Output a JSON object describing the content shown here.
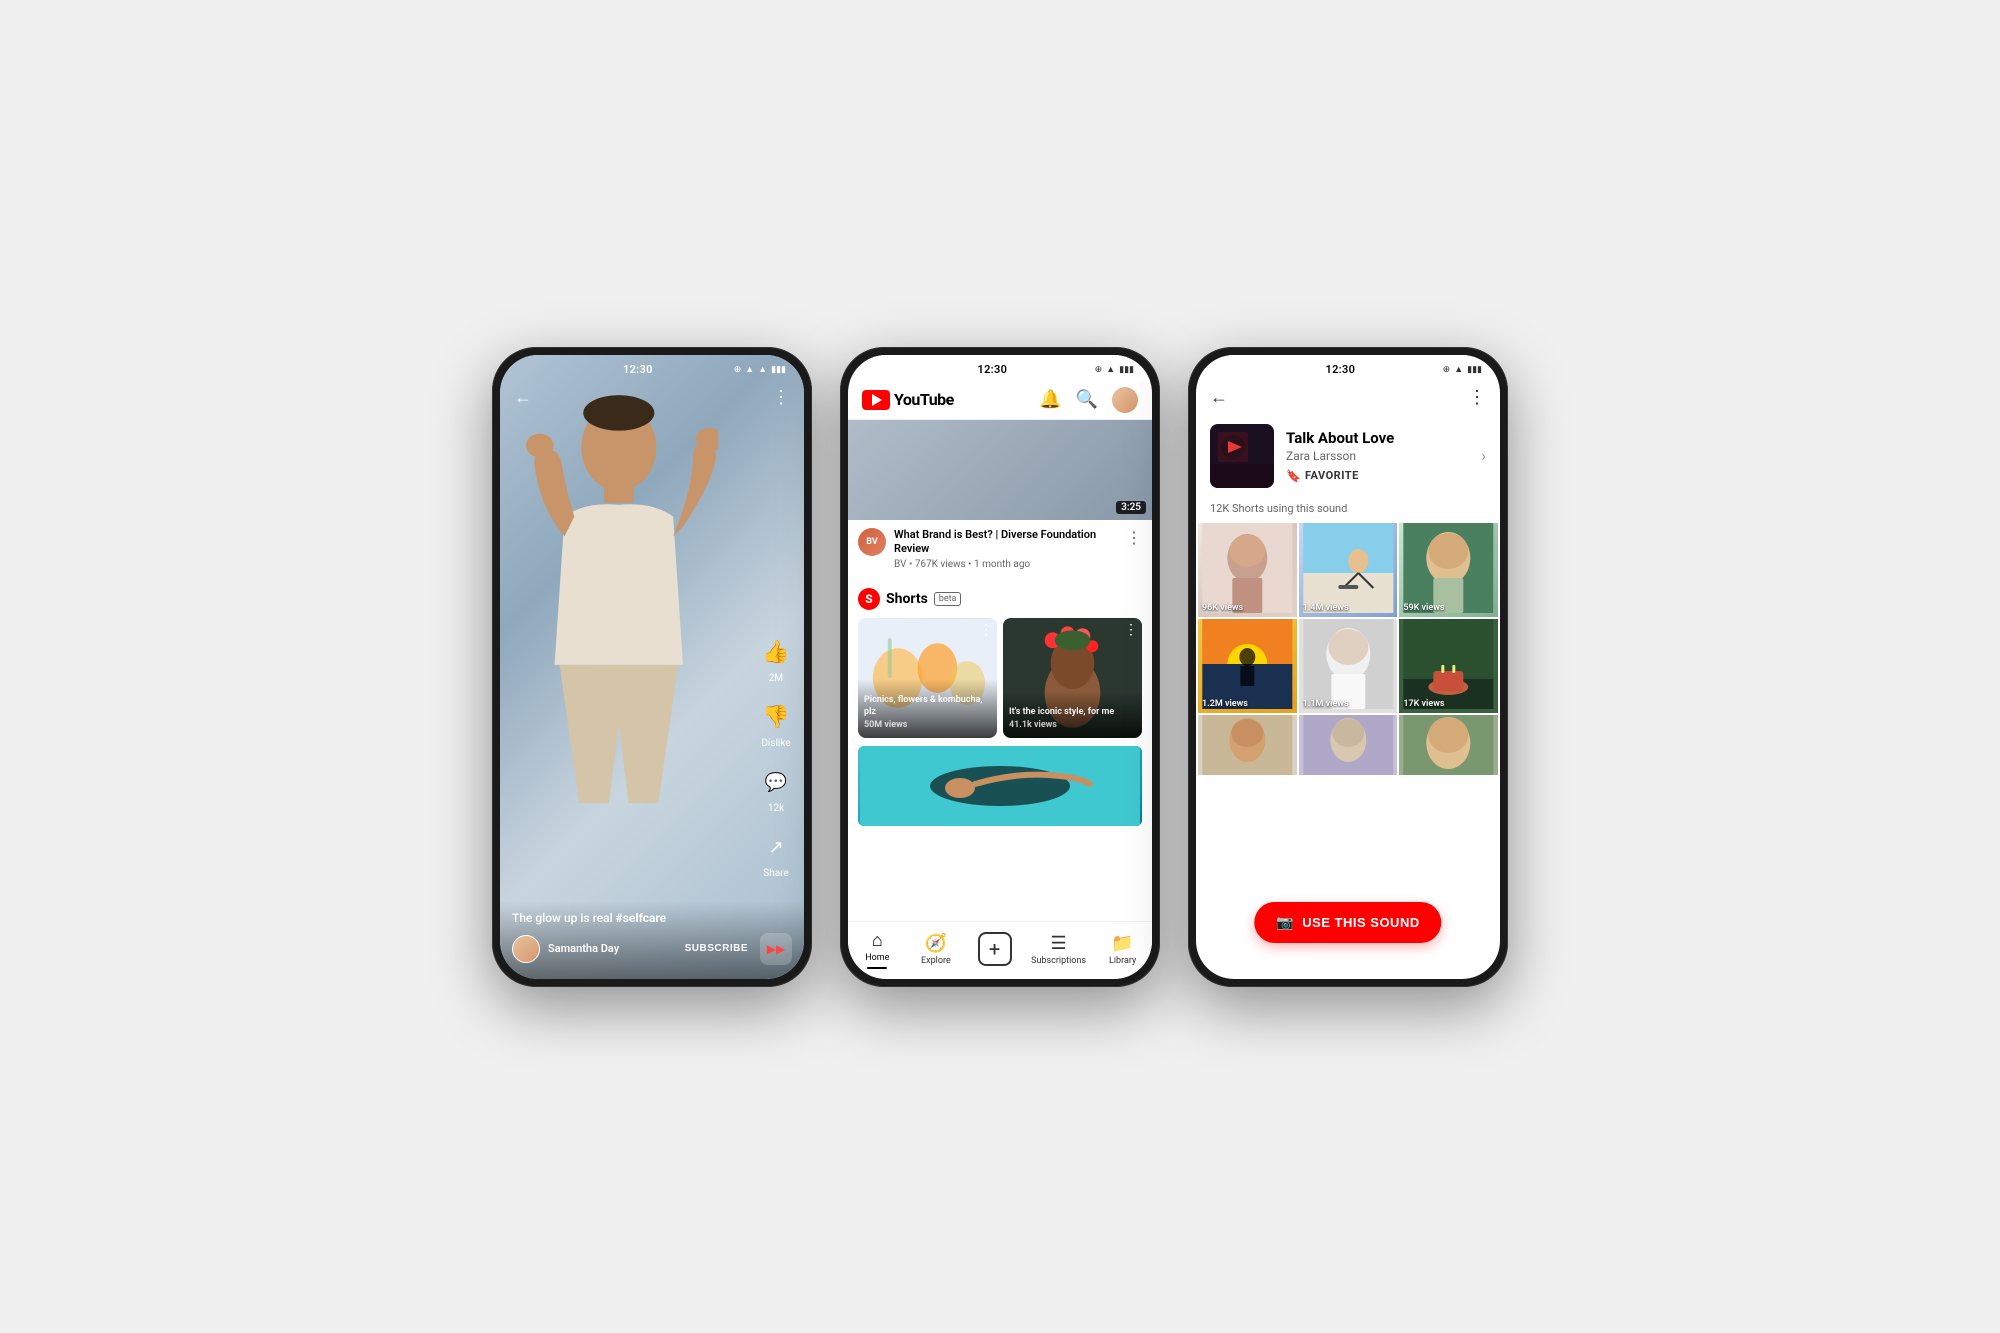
{
  "phones": {
    "phone1": {
      "status": {
        "time": "12:30",
        "icons": "⊕ ▲ ▲ ▮"
      },
      "caption": "The glow up is real",
      "hashtag": "#selfcare",
      "username": "Samantha Day",
      "subscribe_label": "SUBSCRIBE",
      "actions": {
        "likes": "2M",
        "dislike_label": "Dislike",
        "comments": "12k",
        "share_label": "Share"
      }
    },
    "phone2": {
      "status": {
        "time": "12:30"
      },
      "header": {
        "logo_text": "YouTube",
        "nav_bell": "🔔",
        "nav_search": "🔍"
      },
      "video": {
        "title": "What Brand is Best? | Diverse Foundation Review",
        "channel": "BV",
        "meta": "BV • 767K views • 1 month ago",
        "duration": "3:25"
      },
      "shorts_section": {
        "title": "Shorts",
        "beta": "beta",
        "items": [
          {
            "label": "Picnics, flowers & kombucha, plz",
            "views": "50M views"
          },
          {
            "label": "It's the iconic style, for me",
            "views": "41.1k views"
          }
        ]
      },
      "bottom_nav": [
        {
          "icon": "⌂",
          "label": "Home",
          "active": true
        },
        {
          "icon": "🧭",
          "label": "Explore",
          "active": false
        },
        {
          "icon": "+",
          "label": "",
          "active": false
        },
        {
          "icon": "☰",
          "label": "Subscriptions",
          "active": false
        },
        {
          "icon": "📁",
          "label": "Library",
          "active": false
        }
      ]
    },
    "phone3": {
      "status": {
        "time": "12:30"
      },
      "song": {
        "title": "Talk About Love",
        "artist": "Zara Larsson",
        "favorite_label": "FAVORITE",
        "using_text": "12K Shorts using this sound"
      },
      "grid_items": [
        {
          "views": "96K views",
          "bg": "g1"
        },
        {
          "views": "1.4M views",
          "bg": "g2"
        },
        {
          "views": "59K views",
          "bg": "g3"
        },
        {
          "views": "1.2M views",
          "bg": "g4"
        },
        {
          "views": "1.1M views",
          "bg": "g5"
        },
        {
          "views": "17K views",
          "bg": "g6"
        },
        {
          "views": "",
          "bg": "g7"
        },
        {
          "views": "",
          "bg": "g8"
        },
        {
          "views": "",
          "bg": "g9"
        }
      ],
      "use_sound_btn": "USE THIS SOUND"
    }
  }
}
